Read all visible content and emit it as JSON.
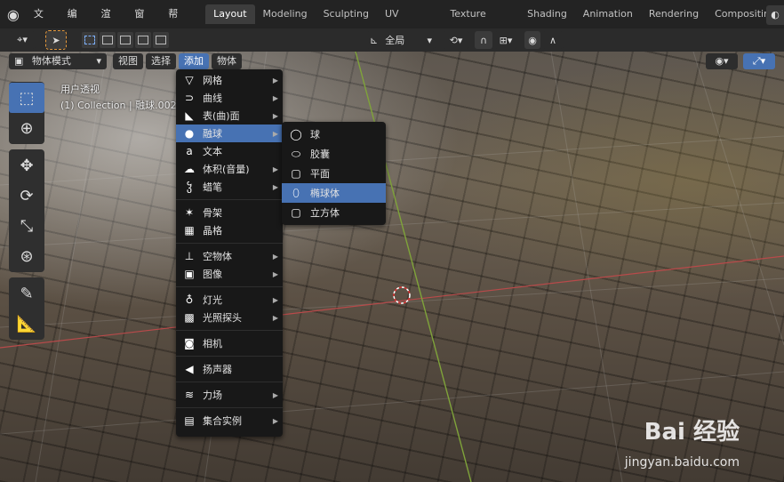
{
  "topbar": {
    "menus": [
      "文件",
      "编辑",
      "渲染",
      "窗口",
      "帮助"
    ],
    "workspaces": [
      "Layout",
      "Modeling",
      "Sculpting",
      "UV Editing",
      "Texture Paint",
      "Shading",
      "Animation",
      "Rendering",
      "Compositing"
    ],
    "active_workspace": "Layout"
  },
  "toolheader": {
    "orientation": "全局"
  },
  "viewport": {
    "mode": "物体模式",
    "header_menus": [
      "视图",
      "选择",
      "添加",
      "物体"
    ],
    "active_menu": "添加",
    "info_line1": "用户透视",
    "info_line2": "(1) Collection | 融球.002"
  },
  "add_menu": {
    "items": [
      {
        "label": "网格",
        "icon": "mesh-icon",
        "glyph": "▽",
        "submenu": true
      },
      {
        "label": "曲线",
        "icon": "curve-icon",
        "glyph": "⊃",
        "submenu": true
      },
      {
        "label": "表(曲)面",
        "icon": "surface-icon",
        "glyph": "◣",
        "submenu": true
      },
      {
        "label": "融球",
        "icon": "metaball-icon",
        "glyph": "●",
        "submenu": true,
        "highlighted": true
      },
      {
        "label": "文本",
        "icon": "text-icon",
        "glyph": "a",
        "submenu": false
      },
      {
        "label": "体积(音量)",
        "icon": "volume-icon",
        "glyph": "☁",
        "submenu": true
      },
      {
        "label": "蜡笔",
        "icon": "grease-pencil-icon",
        "glyph": "ჴ",
        "submenu": true
      },
      {
        "separator": true
      },
      {
        "label": "骨架",
        "icon": "armature-icon",
        "glyph": "✶",
        "submenu": false
      },
      {
        "label": "晶格",
        "icon": "lattice-icon",
        "glyph": "▦",
        "submenu": false
      },
      {
        "separator": true
      },
      {
        "label": "空物体",
        "icon": "empty-icon",
        "glyph": "⊥",
        "submenu": true
      },
      {
        "label": "图像",
        "icon": "image-icon",
        "glyph": "▣",
        "submenu": true
      },
      {
        "separator": true
      },
      {
        "label": "灯光",
        "icon": "light-icon",
        "glyph": "♁",
        "submenu": true
      },
      {
        "label": "光照探头",
        "icon": "light-probe-icon",
        "glyph": "▩",
        "submenu": true
      },
      {
        "separator": true
      },
      {
        "label": "相机",
        "icon": "camera-icon",
        "glyph": "◙",
        "submenu": false
      },
      {
        "separator": true
      },
      {
        "label": "扬声器",
        "icon": "speaker-icon",
        "glyph": "◀",
        "submenu": false
      },
      {
        "separator": true
      },
      {
        "label": "力场",
        "icon": "force-field-icon",
        "glyph": "≋",
        "submenu": true
      },
      {
        "separator": true
      },
      {
        "label": "集合实例",
        "icon": "collection-instance-icon",
        "glyph": "▤",
        "submenu": true
      }
    ]
  },
  "metaball_submenu": {
    "items": [
      {
        "label": "球",
        "icon": "ball-icon",
        "glyph": "◯"
      },
      {
        "label": "胶囊",
        "icon": "capsule-icon",
        "glyph": "⬭"
      },
      {
        "label": "平面",
        "icon": "plane-icon",
        "glyph": "▢"
      },
      {
        "label": "椭球体",
        "icon": "ellipsoid-icon",
        "glyph": "⬯",
        "highlighted": true
      },
      {
        "label": "立方体",
        "icon": "cube-icon",
        "glyph": "▢"
      }
    ]
  },
  "watermark": {
    "brand": "Bai 经验",
    "url": "jingyan.baidu.com"
  }
}
